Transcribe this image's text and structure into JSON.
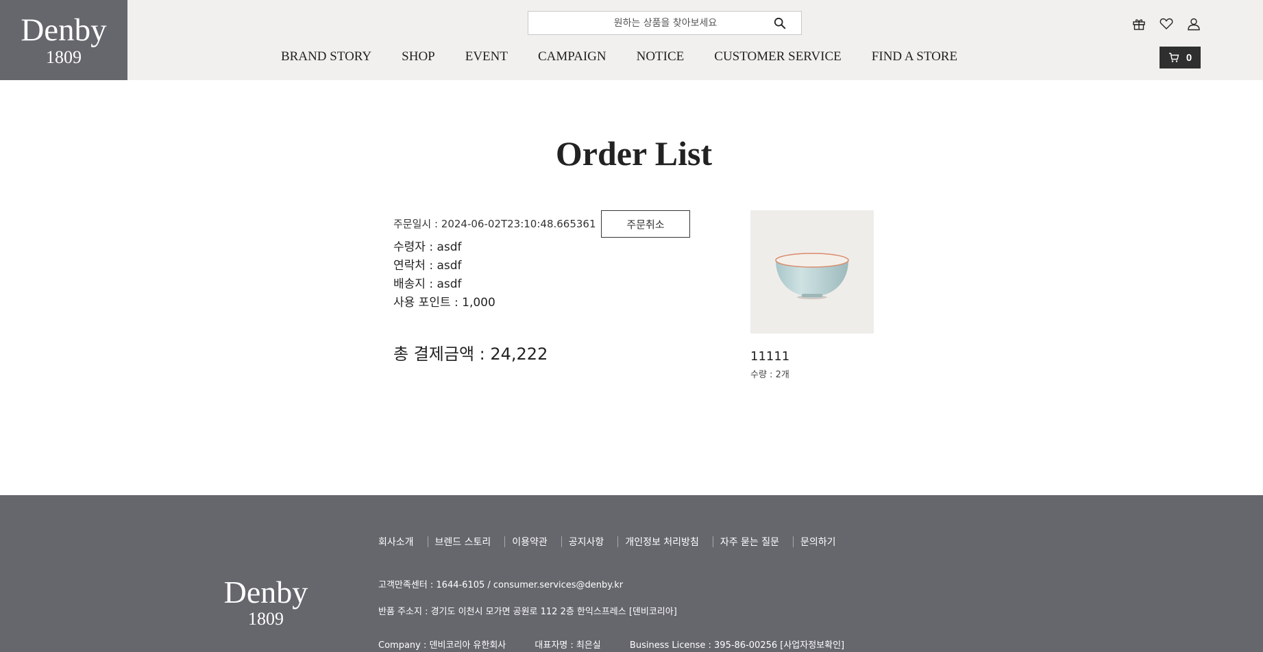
{
  "header": {
    "logo_name": "Denby",
    "logo_year": "1809",
    "search_placeholder": "원하는 상품을 찾아보세요",
    "nav": [
      "BRAND STORY",
      "SHOP",
      "EVENT",
      "CAMPAIGN",
      "NOTICE",
      "CUSTOMER SERVICE",
      "FIND A STORE"
    ],
    "icons": [
      "gift-icon",
      "heart-icon",
      "user-icon"
    ],
    "cart_count": "0"
  },
  "main": {
    "title": "Order List",
    "order_date": "주문일시 : 2024-06-02T23:10:48.665361",
    "cancel_label": "주문취소",
    "recipient": "수령자 : asdf",
    "contact": "연락처 : asdf",
    "address": "배송지 : asdf",
    "points": "사용 포인트 : 1,000",
    "total": "총 결제금액 : 24,222",
    "product": {
      "name": "11111",
      "quantity": "수량 : 2개"
    }
  },
  "footer": {
    "logo_name": "Denby",
    "logo_year": "1809",
    "links": [
      "회사소개",
      "브렌드 스토리",
      "이용약관",
      "공지사항",
      "개인정보 처리방침",
      "자주 묻는 질문",
      "문의하기"
    ],
    "cs_center": "고객만족센터 : 1644-6105 / consumer.services@denby.kr",
    "return_address": "반품 주소지 : 경기도 이천시 모가면 공원로 112 2층 한익스프레스 [덴비코리아]",
    "company": "Company : 덴비코리아 유한회사",
    "ceo": "대표자명 : 최은실",
    "license": "Business License : 395-86-00256 [사업자정보확인]"
  },
  "colors": {
    "header_bg": "#f1f0ee",
    "logo_bg": "#66676d",
    "footer_bg": "#66676d",
    "cart_bg": "#2f2f2f"
  }
}
